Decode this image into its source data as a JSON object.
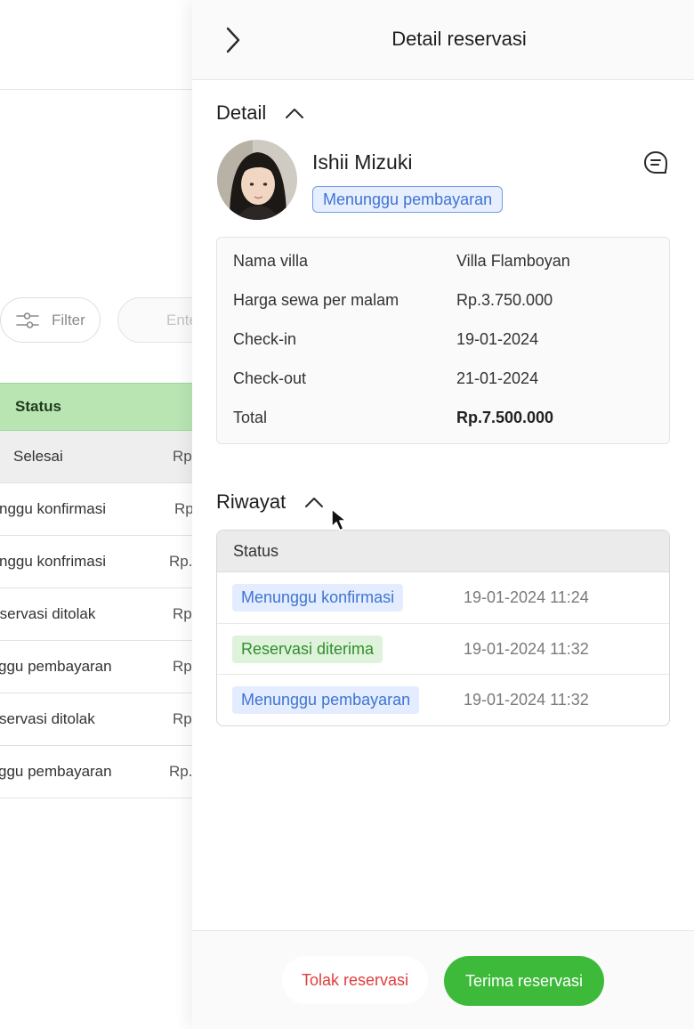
{
  "background": {
    "filter_label": "Filter",
    "search_placeholder": "Ente",
    "table_header_status": "Status",
    "rows": [
      {
        "status": "Selesai",
        "price": "Rp"
      },
      {
        "status": "nggu konfirmasi",
        "price": "Rp"
      },
      {
        "status": "nggu konfrimasi",
        "price": "Rp."
      },
      {
        "status": "rservasi ditolak",
        "price": "Rp"
      },
      {
        "status": "ggu pembayaran",
        "price": "Rp"
      },
      {
        "status": "servasi ditolak",
        "price": "Rp"
      },
      {
        "status": "ggu pembayaran",
        "price": "Rp."
      }
    ]
  },
  "drawer": {
    "title": "Detail reservasi",
    "detail_section": "Detail",
    "guest_name": "Ishii Mizuki",
    "guest_status": "Menunggu pembayaran",
    "info": [
      {
        "key": "Nama villa",
        "value": "Villa Flamboyan"
      },
      {
        "key": "Harga sewa per malam",
        "value": "Rp.3.750.000"
      },
      {
        "key": "Check-in",
        "value": "19-01-2024"
      },
      {
        "key": "Check-out",
        "value": "21-01-2024"
      },
      {
        "key": "Total",
        "value": "Rp.7.500.000"
      }
    ],
    "history_section": "Riwayat",
    "history_header": "Status",
    "history": [
      {
        "status": "Menunggu konfirmasi",
        "time": "19-01-2024 11:24",
        "color": "#3f74d0"
      },
      {
        "status": "Reservasi diterima",
        "time": "19-01-2024 11:32",
        "color": "#2f8f2a"
      },
      {
        "status": "Menunggu pembayaran",
        "time": "19-01-2024 11:32",
        "color": "#3f74d0"
      }
    ],
    "reject_label": "Tolak reservasi",
    "accept_label": "Terima reservasi"
  },
  "colors": {
    "accent_green": "#3dba3a",
    "table_header_green": "#b9e5b3",
    "status_blue": "#3f74d0",
    "reject_red": "#e03d3d"
  },
  "icons": [
    "filter-icon",
    "chevron-right-icon",
    "chevron-up-icon",
    "chat-icon",
    "mouse-cursor-icon"
  ]
}
